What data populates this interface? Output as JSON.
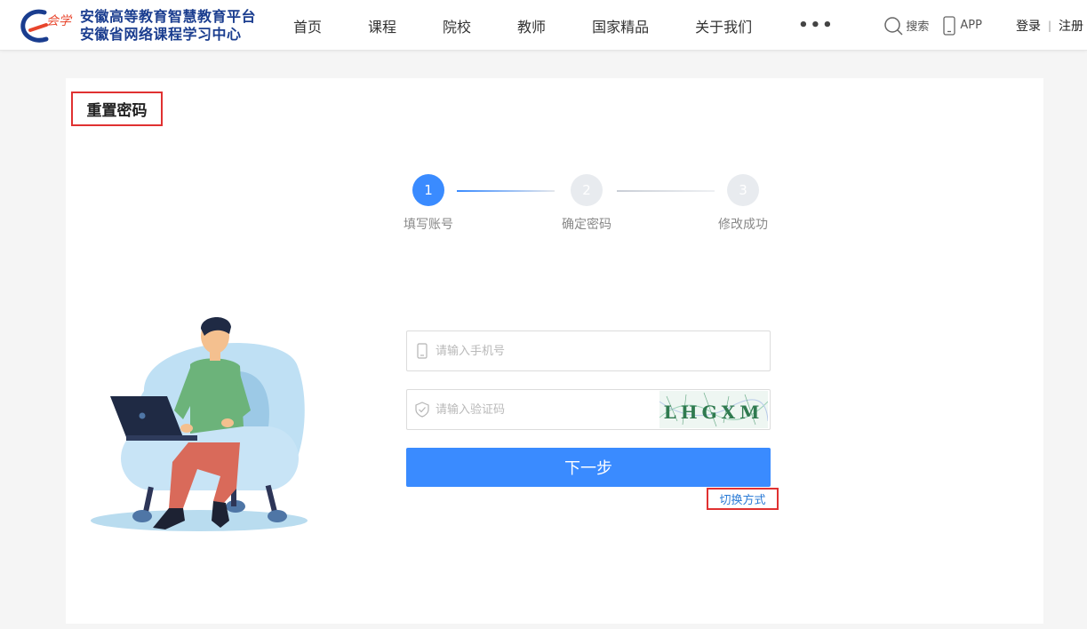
{
  "header": {
    "logo_mark_text": "会学",
    "logo_line1": "安徽高等教育智慧教育平台",
    "logo_line2": "安徽省网络课程学习中心",
    "nav": [
      "首页",
      "课程",
      "院校",
      "教师",
      "国家精品",
      "关于我们"
    ],
    "more": "•••",
    "search_label": "搜索",
    "app_label": "APP",
    "login": "登录",
    "separator": "|",
    "register": "注册"
  },
  "page": {
    "title": "重置密码"
  },
  "steps": [
    {
      "number": "1",
      "label": "填写账号"
    },
    {
      "number": "2",
      "label": "确定密码"
    },
    {
      "number": "3",
      "label": "修改成功"
    }
  ],
  "form": {
    "phone_placeholder": "请输入手机号",
    "phone_value": "",
    "code_placeholder": "请输入验证码",
    "code_value": "",
    "captcha_text": "LHGXM",
    "next_label": "下一步",
    "switch_label": "切换方式"
  },
  "colors": {
    "primary": "#3a8bff",
    "highlight": "#e03131",
    "logo": "#1a3d8f",
    "link": "#2b7bd6"
  }
}
